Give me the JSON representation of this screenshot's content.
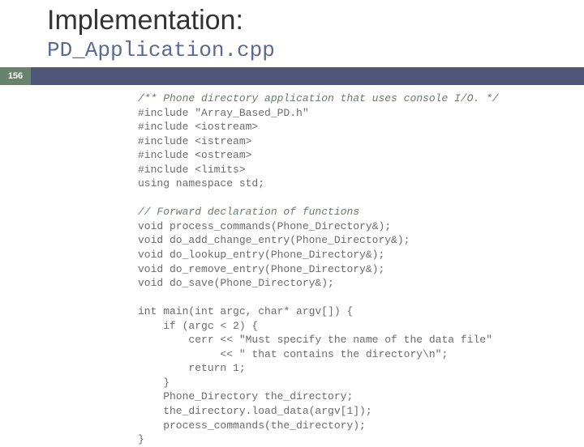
{
  "slide": {
    "title": "Implementation:",
    "subtitle": "PD_Application.cpp",
    "page_number": "156"
  },
  "code": {
    "c0": "/** Phone directory application that uses console I/O. */",
    "c1": "#include \"Array_Based_PD.h\"",
    "c2": "#include <iostream>",
    "c3": "#include <istream>",
    "c4": "#include <ostream>",
    "c5": "#include <limits>",
    "c6": "using namespace std;",
    "c7": "",
    "c8": "// Forward declaration of functions",
    "c9": "void process_commands(Phone_Directory&);",
    "c10": "void do_add_change_entry(Phone_Directory&);",
    "c11": "void do_lookup_entry(Phone_Directory&);",
    "c12": "void do_remove_entry(Phone_Directory&);",
    "c13": "void do_save(Phone_Directory&);",
    "c14": "",
    "c15": "int main(int argc, char* argv[]) {",
    "c16": "    if (argc < 2) {",
    "c17": "        cerr << \"Must specify the name of the data file\"",
    "c18": "             << \" that contains the directory\\n\";",
    "c19": "        return 1;",
    "c20": "    }",
    "c21": "    Phone_Directory the_directory;",
    "c22": "    the_directory.load_data(argv[1]);",
    "c23": "    process_commands(the_directory);",
    "c24": "}"
  }
}
